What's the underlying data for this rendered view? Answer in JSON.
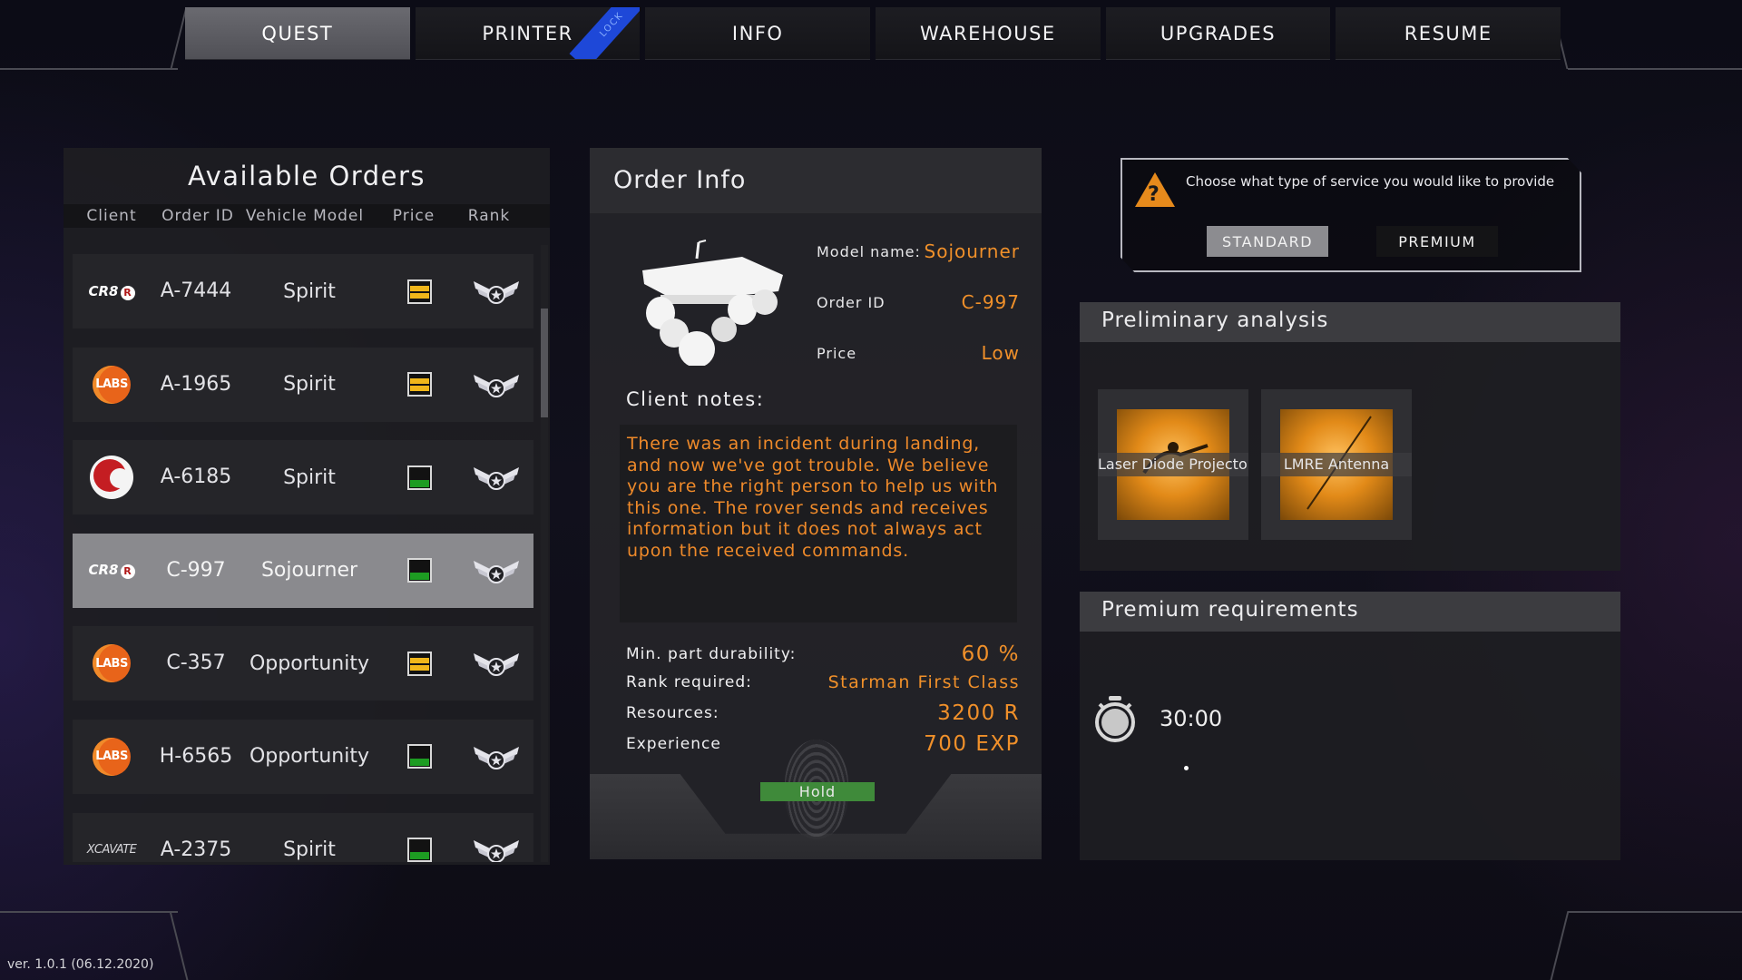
{
  "nav": {
    "tabs": [
      {
        "label": "QUEST",
        "active": true
      },
      {
        "label": "PRINTER",
        "active": false,
        "ribbon": "LOCK"
      },
      {
        "label": "INFO",
        "active": false
      },
      {
        "label": "WAREHOUSE",
        "active": false
      },
      {
        "label": "UPGRADES",
        "active": false
      },
      {
        "label": "RESUME",
        "active": false
      }
    ]
  },
  "orders": {
    "title": "Available Orders",
    "columns": [
      "Client",
      "Order ID",
      "Vehicle Model",
      "Price",
      "Rank"
    ],
    "rows": [
      {
        "client": "CR8R",
        "order_id": "A-7444",
        "model": "Spirit",
        "price": "medium",
        "selected": false
      },
      {
        "client": "LABS",
        "order_id": "A-1965",
        "model": "Spirit",
        "price": "medium",
        "selected": false
      },
      {
        "client": "red-circle",
        "order_id": "A-6185",
        "model": "Spirit",
        "price": "low",
        "selected": false
      },
      {
        "client": "CR8R",
        "order_id": "C-997",
        "model": "Sojourner",
        "price": "low",
        "selected": true
      },
      {
        "client": "LABS",
        "order_id": "C-357",
        "model": "Opportunity",
        "price": "medium",
        "selected": false
      },
      {
        "client": "LABS",
        "order_id": "H-6565",
        "model": "Opportunity",
        "price": "low",
        "selected": false
      },
      {
        "client": "XCAVATE",
        "order_id": "A-2375",
        "model": "Spirit",
        "price": "low",
        "selected": false
      }
    ]
  },
  "info": {
    "title": "Order Info",
    "model_name_label": "Model name:",
    "model_name": "Sojourner",
    "order_id_label": "Order ID",
    "order_id": "C-997",
    "price_label": "Price",
    "price": "Low",
    "notes_title": "Client notes:",
    "notes": "There was an incident during landing, and now we've got trouble. We believe you are the right person to help us with this one. The rover sends and receives information but it does not always act upon the received commands.",
    "durability_label": "Min. part durability:",
    "durability": "60 %",
    "rank_label": "Rank required:",
    "rank": "Starman First Class",
    "resources_label": "Resources:",
    "resources": "3200 R",
    "experience_label": "Experience",
    "experience": "700 EXP",
    "hold_label": "Hold"
  },
  "service": {
    "prompt": "Choose what type of service you would like to provide",
    "standard_label": "STANDARD",
    "premium_label": "PREMIUM",
    "selected": "standard"
  },
  "analysis": {
    "title": "Preliminary analysis",
    "parts": [
      {
        "name": "Laser Diode Projector"
      },
      {
        "name": "LMRE Antenna"
      }
    ]
  },
  "premium": {
    "title": "Premium requirements",
    "timer": "30:00"
  },
  "version": "ver. 1.0.1 (06.12.2020)",
  "colors": {
    "accent_orange": "#f0902a",
    "price_yellow": "#f0b61a",
    "price_green": "#1d9c22",
    "hold_green": "#3f8a3a"
  }
}
